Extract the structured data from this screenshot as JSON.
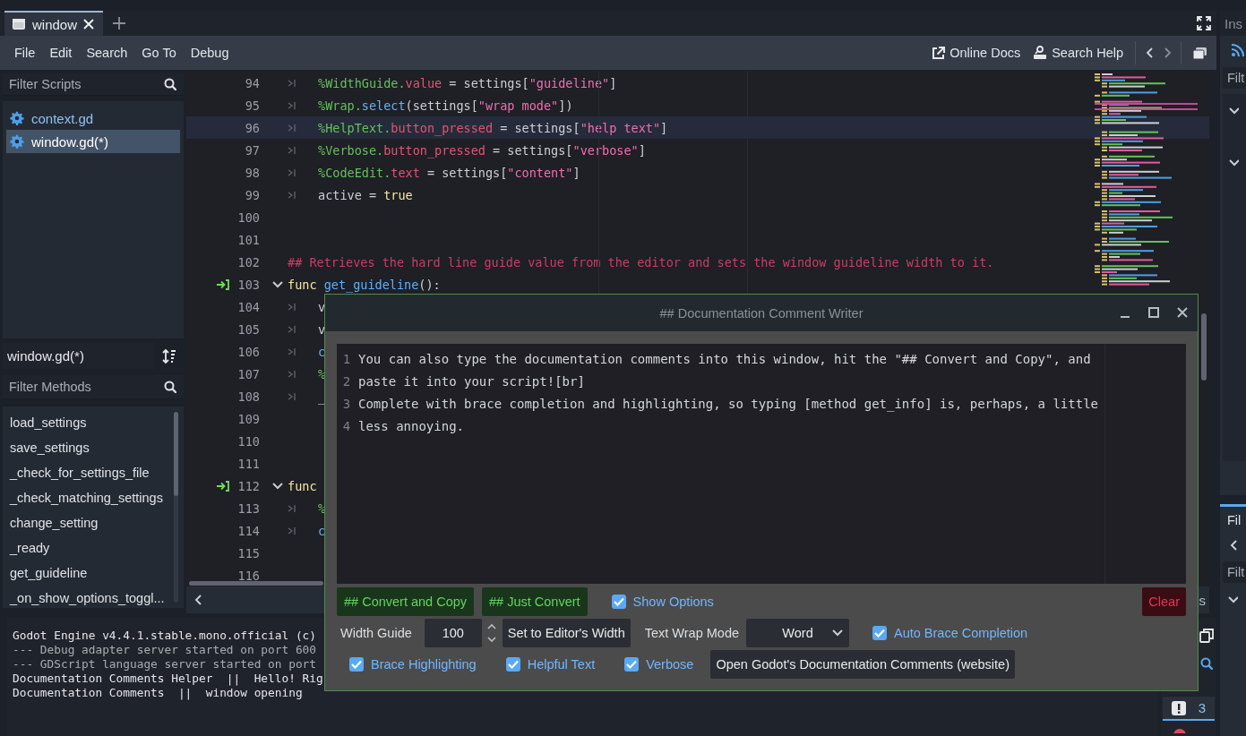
{
  "tabs": [
    {
      "label": "window",
      "selected": true
    }
  ],
  "menu": [
    "File",
    "Edit",
    "Search",
    "Go To",
    "Debug"
  ],
  "help_links": [
    {
      "label": "Online Docs",
      "kind": "external"
    },
    {
      "label": "Search Help",
      "kind": "doc"
    }
  ],
  "scripts": {
    "placeholder": "Filter Scripts",
    "items": [
      {
        "name": "context.gd",
        "selected": false
      },
      {
        "name": "window.gd(*)",
        "selected": true
      }
    ]
  },
  "current_script": "window.gd(*)",
  "methods": {
    "placeholder": "Filter Methods",
    "items": [
      "load_settings",
      "save_settings",
      "_check_for_settings_file",
      "_check_matching_settings",
      "change_setting",
      "_ready",
      "get_guideline",
      "_on_show_options_toggl..."
    ]
  },
  "code": {
    "lines": [
      {
        "num": "94",
        "tab": true,
        "bookmark": false,
        "fold": false,
        "current": false,
        "tokens": [
          {
            "kind": "node",
            "text": "%WidthGuide."
          },
          {
            "kind": "member",
            "text": "value"
          },
          {
            "kind": "text",
            "text": " = settings["
          },
          {
            "kind": "string",
            "text": "\"guideline\""
          },
          {
            "kind": "text",
            "text": "]"
          }
        ]
      },
      {
        "num": "95",
        "tab": true,
        "bookmark": false,
        "fold": false,
        "current": false,
        "tokens": [
          {
            "kind": "node",
            "text": "%Wrap."
          },
          {
            "kind": "method",
            "text": "select"
          },
          {
            "kind": "text",
            "text": "(settings["
          },
          {
            "kind": "string",
            "text": "\"wrap mode\""
          },
          {
            "kind": "text",
            "text": "])"
          }
        ]
      },
      {
        "num": "96",
        "tab": true,
        "bookmark": false,
        "fold": false,
        "current": true,
        "tokens": [
          {
            "kind": "node",
            "text": "%HelpText."
          },
          {
            "kind": "member",
            "text": "button_pressed"
          },
          {
            "kind": "text",
            "text": " = settings["
          },
          {
            "kind": "string",
            "text": "\"help text\""
          },
          {
            "kind": "text",
            "text": "]"
          }
        ]
      },
      {
        "num": "97",
        "tab": true,
        "bookmark": false,
        "fold": false,
        "current": false,
        "tokens": [
          {
            "kind": "node",
            "text": "%Verbose."
          },
          {
            "kind": "member",
            "text": "button_pressed"
          },
          {
            "kind": "text",
            "text": " = settings["
          },
          {
            "kind": "string",
            "text": "\"verbose\""
          },
          {
            "kind": "text",
            "text": "]"
          }
        ]
      },
      {
        "num": "98",
        "tab": true,
        "bookmark": false,
        "fold": false,
        "current": false,
        "tokens": [
          {
            "kind": "node",
            "text": "%CodeEdit."
          },
          {
            "kind": "member",
            "text": "text"
          },
          {
            "kind": "text",
            "text": " = settings["
          },
          {
            "kind": "string",
            "text": "\"content\""
          },
          {
            "kind": "text",
            "text": "]"
          }
        ]
      },
      {
        "num": "99",
        "tab": true,
        "bookmark": false,
        "fold": false,
        "current": false,
        "tokens": [
          {
            "kind": "text",
            "text": "active = "
          },
          {
            "kind": "keyword",
            "text": "true"
          }
        ]
      },
      {
        "num": "100",
        "tab": false,
        "bookmark": false,
        "fold": false,
        "current": false
      },
      {
        "num": "101",
        "tab": false,
        "bookmark": false,
        "fold": false,
        "current": false
      },
      {
        "num": "102",
        "tab": false,
        "bookmark": false,
        "fold": false,
        "current": false,
        "tokens": [
          {
            "kind": "comment",
            "text": "## Retrieves the hard line guide value from the editor and sets the window guideline width to it."
          }
        ]
      },
      {
        "num": "103",
        "tab": false,
        "bookmark": true,
        "fold": true,
        "current": false,
        "tokens": [
          {
            "kind": "keyword",
            "text": "func"
          },
          {
            "kind": "function",
            "text": " get_guideline"
          },
          {
            "kind": "text",
            "text": "():"
          }
        ]
      },
      {
        "num": "104",
        "tab": true,
        "bookmark": false,
        "fold": false,
        "current": false,
        "tokens": [
          {
            "kind": "text",
            "text": "v"
          }
        ]
      },
      {
        "num": "105",
        "tab": true,
        "bookmark": false,
        "fold": false,
        "current": false,
        "tokens": [
          {
            "kind": "text",
            "text": "v"
          }
        ]
      },
      {
        "num": "106",
        "tab": true,
        "bookmark": false,
        "fold": false,
        "current": false,
        "tokens": [
          {
            "kind": "method",
            "text": "c"
          }
        ]
      },
      {
        "num": "107",
        "tab": true,
        "bookmark": false,
        "fold": false,
        "current": false,
        "tokens": [
          {
            "kind": "node",
            "text": "%"
          }
        ]
      },
      {
        "num": "108",
        "tab": true,
        "bookmark": false,
        "fold": false,
        "current": false,
        "tokens": [
          {
            "kind": "text",
            "text": "_"
          }
        ]
      },
      {
        "num": "109",
        "tab": false,
        "bookmark": false,
        "fold": false,
        "current": false
      },
      {
        "num": "110",
        "tab": false,
        "bookmark": false,
        "fold": false,
        "current": false
      },
      {
        "num": "111",
        "tab": false,
        "bookmark": false,
        "fold": false,
        "current": false
      },
      {
        "num": "112",
        "tab": false,
        "bookmark": true,
        "fold": true,
        "current": false,
        "tokens": [
          {
            "kind": "keyword",
            "text": "func"
          }
        ]
      },
      {
        "num": "113",
        "tab": true,
        "bookmark": false,
        "fold": false,
        "current": false,
        "tokens": [
          {
            "kind": "node",
            "text": "%"
          }
        ]
      },
      {
        "num": "114",
        "tab": true,
        "bookmark": false,
        "fold": false,
        "current": false,
        "tokens": [
          {
            "kind": "method",
            "text": "c"
          }
        ]
      },
      {
        "num": "115",
        "tab": false,
        "bookmark": false,
        "fold": false,
        "current": false
      },
      {
        "num": "116",
        "tab": false,
        "bookmark": false,
        "fold": false,
        "current": false
      }
    ],
    "status_fragment": "s"
  },
  "console": {
    "lines": [
      "Godot Engine v4.4.1.stable.mono.official (c)",
      "--- Debug adapter server started on port 600",
      "--- GDScript language server started on port",
      "Documentation Comments Helper  ||  Hello! Rig",
      "Documentation Comments  ||  window opening"
    ],
    "warnings": "3"
  },
  "dock": {
    "tab": "Ins",
    "filter": "Filt",
    "files_tab": "Fil",
    "files_filter": "Filt"
  },
  "dialog": {
    "title": "## Documentation Comment Writer",
    "editor_lines": [
      {
        "num": "1",
        "text": "You can also type the documentation comments into this window, hit the \"## Convert and Copy\", and"
      },
      {
        "num": "2",
        "text": "paste it into your script![br]"
      },
      {
        "num": "3",
        "text": "Complete with brace completion and highlighting, so typing [method get_info] is, perhaps, a little"
      },
      {
        "num": "4",
        "text": "less annoying."
      }
    ],
    "buttons": [
      "## Convert and Copy",
      "## Just Convert"
    ],
    "show_options": {
      "label": "Show Options",
      "checked": true
    },
    "clear": "Clear",
    "width_guide": {
      "label": "Width Guide",
      "value": "100"
    },
    "set_width": "Set to Editor's Width",
    "wrap_mode": {
      "label": "Text Wrap Mode",
      "value": "Word"
    },
    "auto_brace": {
      "label": "Auto Brace Completion",
      "checked": true
    },
    "options": [
      {
        "label": "Brace Highlighting",
        "checked": true
      },
      {
        "label": "Helpful Text",
        "checked": true
      },
      {
        "label": "Verbose",
        "checked": true
      }
    ],
    "docs_button": "Open Godot's Documentation Comments (website)"
  }
}
